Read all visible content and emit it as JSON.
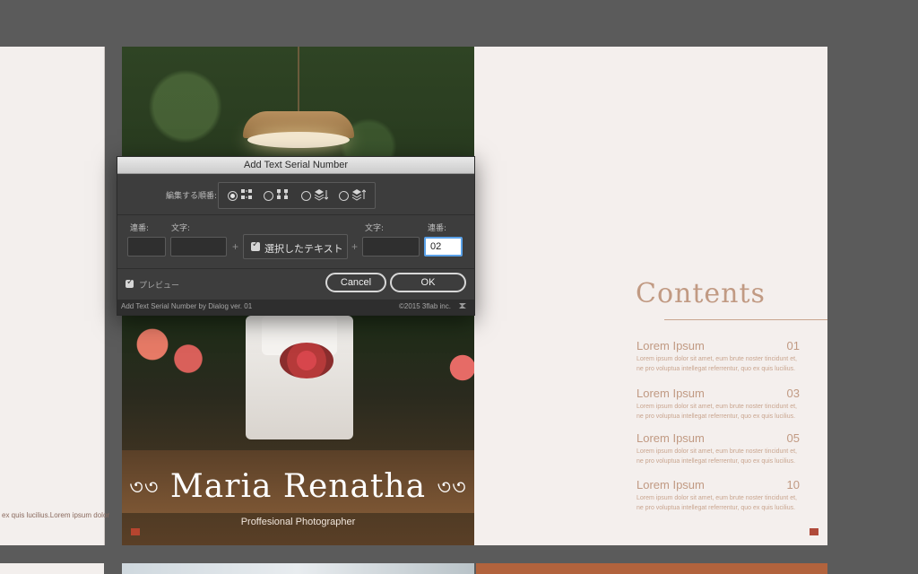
{
  "left_page": {
    "tiny_text": "ex quis lucilius.Lorem ipsum dolor"
  },
  "photo_page": {
    "title_left_flourish": "৩৩",
    "title": "Maria Renatha",
    "title_right_flourish": "৩৩",
    "subtitle": "Proffesional Photographer"
  },
  "contents_page": {
    "heading": "Contents",
    "entries": [
      {
        "name": "Lorem Ipsum",
        "page": "01",
        "body": "Lorem ipsum dolor sit amet, eum brute noster tincidunt et, ne pro voluptua intellegat referrentur, quo ex quis lucilius."
      },
      {
        "name": "Lorem Ipsum",
        "page": "03",
        "body": "Lorem ipsum dolor sit amet, eum brute noster tincidunt et, ne pro voluptua intellegat referrentur, quo ex quis lucilius."
      },
      {
        "name": "Lorem Ipsum",
        "page": "05",
        "body": "Lorem ipsum dolor sit amet, eum brute noster tincidunt et, ne pro voluptua intellegat referrentur, quo ex quis lucilius."
      },
      {
        "name": "Lorem Ipsum",
        "page": "10",
        "body": "Lorem ipsum dolor sit amet, eum brute noster tincidunt et, ne pro voluptua intellegat referrentur, quo ex quis lucilius."
      }
    ]
  },
  "dialog": {
    "title": "Add Text Serial Number",
    "order_label": "編集する順番:",
    "order_options": [
      {
        "icon": "grid-row-order-icon",
        "selected": true
      },
      {
        "icon": "grid-column-order-icon",
        "selected": false
      },
      {
        "icon": "layers-down-order-icon",
        "selected": false
      },
      {
        "icon": "layers-up-order-icon",
        "selected": false
      }
    ],
    "label_serial_left": "連番:",
    "label_text_left": "文字:",
    "label_text_right": "文字:",
    "label_serial_right": "連番:",
    "serial_left_value": "",
    "text_left_value": "",
    "selected_text_label": "選択したテキスト",
    "selected_text_checked": true,
    "text_right_value": "",
    "serial_right_value": "02",
    "plus": "+",
    "preview_label": "プレビュー",
    "preview_checked": true,
    "cancel_label": "Cancel",
    "ok_label": "OK",
    "footer_left": "Add Text Serial Number by Dialog ver. 01",
    "footer_right": "©2015 3flab inc."
  }
}
